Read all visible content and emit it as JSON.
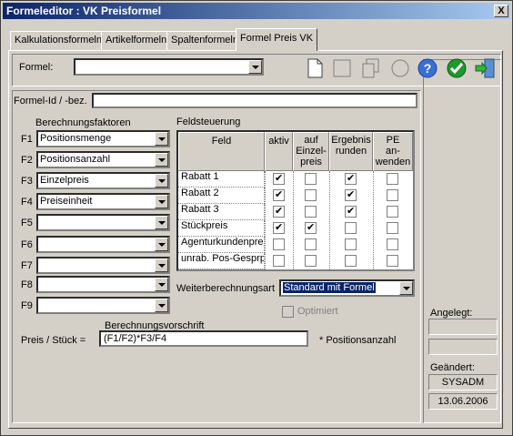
{
  "window": {
    "title": "Formeleditor : VK Preisformel",
    "close_label": "X"
  },
  "tabs": [
    {
      "label": "Kalkulationsformeln"
    },
    {
      "label": "Artikelformeln"
    },
    {
      "label": "Spaltenformeln"
    },
    {
      "label": "Formel Preis VK"
    }
  ],
  "formel": {
    "label": "Formel:",
    "value": ""
  },
  "toolbar": {
    "icons": [
      "new-document-icon",
      "blank-square-icon",
      "copy-icon",
      "circle-icon",
      "help-icon",
      "ok-check-icon",
      "exit-icon"
    ]
  },
  "formel_id": {
    "label": "Formel-Id / -bez.",
    "value": ""
  },
  "berechnungsfaktoren": {
    "label": "Berechnungsfaktoren",
    "items": [
      {
        "key": "F1",
        "value": "Positionsmenge"
      },
      {
        "key": "F2",
        "value": "Positionsanzahl"
      },
      {
        "key": "F3",
        "value": "Einzelpreis"
      },
      {
        "key": "F4",
        "value": "Preiseinheit"
      },
      {
        "key": "F5",
        "value": ""
      },
      {
        "key": "F6",
        "value": ""
      },
      {
        "key": "F7",
        "value": ""
      },
      {
        "key": "F8",
        "value": ""
      },
      {
        "key": "F9",
        "value": ""
      }
    ]
  },
  "feldsteuerung": {
    "label": "Feldsteuerung",
    "headers": [
      "Feld",
      "aktiv",
      "auf\nEinzel-\npreis",
      "Ergebnis\nrunden",
      "PE\nan-\nwenden"
    ],
    "rows": [
      {
        "feld": "Rabatt 1",
        "aktiv": true,
        "einzelpreis": false,
        "runden": true,
        "pe": false
      },
      {
        "feld": "Rabatt 2",
        "aktiv": true,
        "einzelpreis": false,
        "runden": true,
        "pe": false
      },
      {
        "feld": "Rabatt 3",
        "aktiv": true,
        "einzelpreis": false,
        "runden": true,
        "pe": false
      },
      {
        "feld": "Stückpreis",
        "aktiv": true,
        "einzelpreis": true,
        "runden": false,
        "pe": false
      },
      {
        "feld": "Agenturkundenpreis",
        "aktiv": false,
        "einzelpreis": false,
        "runden": false,
        "pe": false
      },
      {
        "feld": "unrab. Pos-Gesprpreis",
        "aktiv": false,
        "einzelpreis": false,
        "runden": false,
        "pe": false
      }
    ]
  },
  "weiterberechnungsart": {
    "label": "Weiterberechnungsart",
    "value": "Standard mit Formel"
  },
  "optimiert": {
    "label": "Optimiert",
    "checked": false
  },
  "berechnungsvorschrift": {
    "label": "Berechnungsvorschrift",
    "prefix": "Preis / Stück =",
    "value": "(F1/F2)*F3/F4",
    "suffix": "* Positionsanzahl"
  },
  "side": {
    "angelegt_label": "Angelegt:",
    "angelegt_user": "",
    "angelegt_date": "",
    "geaendert_label": "Geändert:",
    "geaendert_user": "SYSADM",
    "geaendert_date": "13.06.2006"
  }
}
